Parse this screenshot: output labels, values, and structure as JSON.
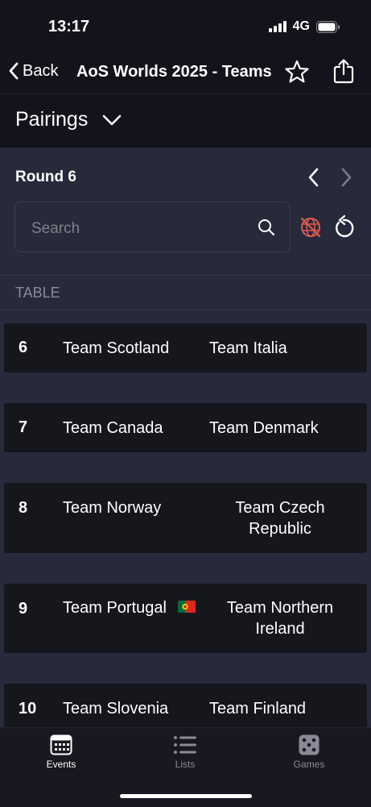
{
  "status_bar": {
    "time": "13:17",
    "network": "4G"
  },
  "nav": {
    "back_label": "Back",
    "title": "AoS Worlds 2025 - Teams",
    "star_icon": "star-icon",
    "share_icon": "share-icon"
  },
  "view_selector": {
    "label": "Pairings"
  },
  "round": {
    "label": "Round 6"
  },
  "search": {
    "placeholder": "Search"
  },
  "table_header": "TABLE",
  "rows": [
    {
      "table": "6",
      "team1": "Team Scotland",
      "team2": "Team Italia"
    },
    {
      "table": "7",
      "team1": "Team Canada",
      "team2": "Team Denmark"
    },
    {
      "table": "8",
      "team1": "Team Norway",
      "team2_line1": "Team Czech",
      "team2_line2": "Republic"
    },
    {
      "table": "9",
      "team1": "Team Portugal",
      "team2_line1": "Team Northern",
      "team2_line2": "Ireland"
    },
    {
      "table": "10",
      "team1": "Team Slovenia",
      "team2": "Team Finland"
    }
  ],
  "tabs": [
    {
      "label": "Events",
      "icon": "calendar-icon",
      "active": true
    },
    {
      "label": "Lists",
      "icon": "list-icon",
      "active": false
    },
    {
      "label": "Games",
      "icon": "dice-icon",
      "active": false
    }
  ],
  "colors": {
    "background": "#262a3a",
    "header": "#13131b",
    "card": "#16161d",
    "globe_icon": "#e0584f",
    "muted": "#8a8a96"
  }
}
